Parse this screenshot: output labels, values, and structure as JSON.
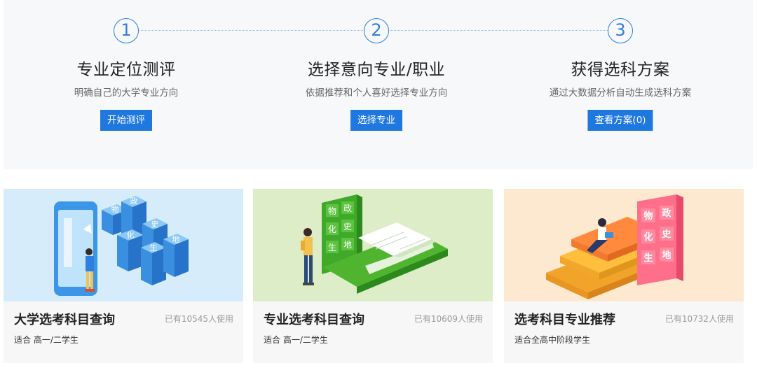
{
  "steps": [
    {
      "number": "1",
      "title": "专业定位测评",
      "desc": "明确自己的大学专业方向",
      "button": "开始测评"
    },
    {
      "number": "2",
      "title": "选择意向专业/职业",
      "desc": "依据推荐和个人喜好选择专业方向",
      "button": "选择专业"
    },
    {
      "number": "3",
      "title": "获得选科方案",
      "desc": "通过大数据分析自动生成选科方案",
      "button": "查看方案(0)"
    }
  ],
  "cards": [
    {
      "title": "大学选考科目查询",
      "usage": "已有10545人使用",
      "subtitle": "适合 高一/二学生",
      "blocks": [
        "物",
        "政",
        "化",
        "史",
        "生",
        "地"
      ],
      "bg": "#d6ecfb"
    },
    {
      "title": "专业选考科目查询",
      "usage": "已有10609人使用",
      "subtitle": "适合 高一/二学生",
      "blocks": [
        "物",
        "政",
        "化",
        "史",
        "生",
        "地"
      ],
      "bg": "#dcedc8"
    },
    {
      "title": "选考科目专业推荐",
      "usage": "已有10732人使用",
      "subtitle": "适合全高中阶段学生",
      "blocks": [
        "物",
        "政",
        "化",
        "史",
        "生",
        "地"
      ],
      "bg": "#fde9cf"
    }
  ],
  "colors": {
    "accent": "#1f78e0",
    "panel_bg": "#f7f8fa"
  }
}
